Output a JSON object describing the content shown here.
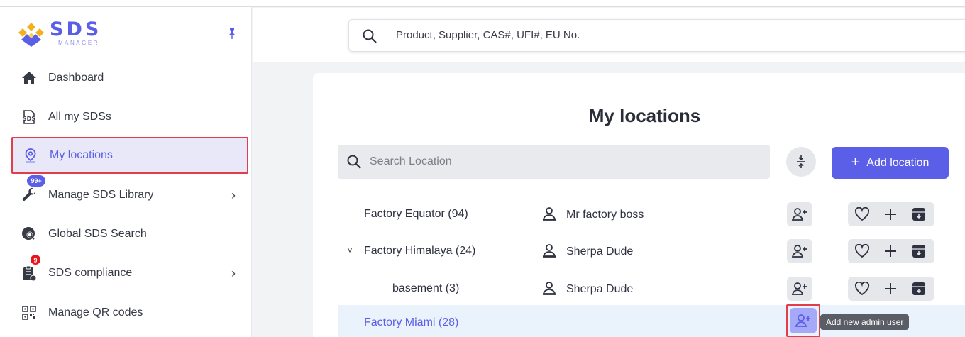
{
  "app": {
    "logo_text": "SDS",
    "logo_sub": "MANAGER"
  },
  "colors": {
    "accent": "#5b5ee6",
    "highlight": "#e23d4a",
    "badge_red": "#e8151b"
  },
  "search": {
    "placeholder": "Product, Supplier, CAS#, UFI#, EU No."
  },
  "sidebar": {
    "items": [
      {
        "label": "Dashboard",
        "icon": "home-icon"
      },
      {
        "label": "All my SDSs",
        "icon": "sds-file-icon"
      },
      {
        "label": "My locations",
        "icon": "location-pin-icon",
        "active": true
      },
      {
        "label": "Manage SDS Library",
        "icon": "wrench-icon",
        "badge": "99+",
        "has_submenu": true
      },
      {
        "label": "Global SDS Search",
        "icon": "globe-search-icon"
      },
      {
        "label": "SDS compliance",
        "icon": "clipboard-icon",
        "badge": "9",
        "has_submenu": true
      },
      {
        "label": "Manage QR codes",
        "icon": "qr-code-icon"
      }
    ]
  },
  "main": {
    "title": "My locations",
    "search_placeholder": "Search Location",
    "add_label": "Add location",
    "add_plus": "+",
    "rows": [
      {
        "name": "Factory Equator (94)",
        "owner": "Mr factory boss"
      },
      {
        "name": "Factory Himalaya (24)",
        "owner": "Sherpa Dude",
        "expanded": true,
        "chevron": "˅"
      },
      {
        "name": "basement (3)",
        "owner": "Sherpa Dude",
        "child": true
      },
      {
        "name": "Factory Miami (28)",
        "owner": "",
        "selected": true
      }
    ],
    "tooltip": "Add new admin user"
  }
}
